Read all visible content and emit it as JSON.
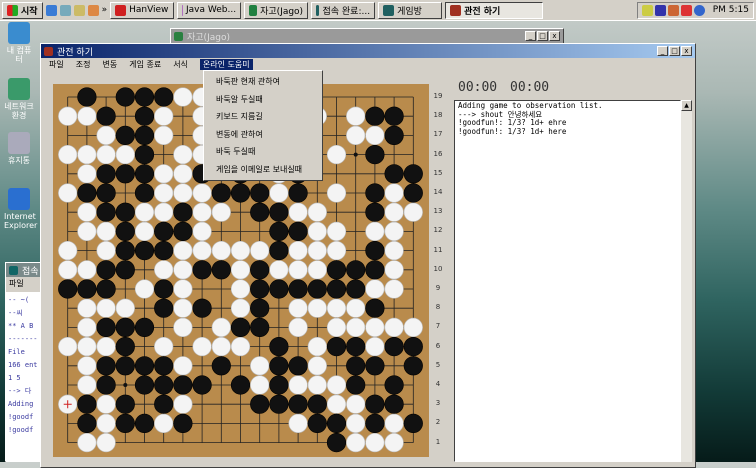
{
  "taskbar": {
    "start": "시작",
    "quicklaunch_more": "»",
    "items": [
      {
        "label": "HanView",
        "color": "#d02020"
      },
      {
        "label": "Java Web...",
        "color": "#b070c0"
      },
      {
        "label": "자고(Jago)",
        "color": "#208040"
      },
      {
        "label": "접속 완료:...",
        "color": "#206060"
      },
      {
        "label": "게임방",
        "color": "#206060"
      },
      {
        "label": "관전 하기",
        "color": "#a03020",
        "active": true
      }
    ],
    "clock": "PM 5:15"
  },
  "desktop": {
    "icons": [
      {
        "label": "내 컴퓨터"
      },
      {
        "label": "네트워크 환경"
      },
      {
        "label": "휴지통"
      },
      {
        "label": "Internet Explorer"
      }
    ]
  },
  "jago_window": {
    "title": "자고(Jago)"
  },
  "small_window": {
    "title": "접속",
    "menu": "파일",
    "lines": [
      "--  ~(",
      "--씨",
      "** A B",
      "-------",
      "File",
      "166 ent",
      "  1 5",
      "--> 다",
      "Adding",
      "!goodf",
      "!goodf"
    ]
  },
  "main_window": {
    "title": "관전 하기",
    "menu": [
      "파일",
      "조정",
      "변동",
      "게임 종료",
      "서식",
      "온라인 도움미"
    ],
    "help_menu": [
      "바둑판 현재 관하여",
      "바둑알 두실때",
      "키보드 지름길",
      "변동에 관하여",
      "바둑 두실때",
      "게임을 이메일로 보내실때"
    ],
    "timers": [
      "00:00",
      "00:00"
    ],
    "log": [
      "Adding game to observation list.",
      "---> shout 안녕하세요",
      "!goodfun!: 1/3?  1d+ ehre",
      "!goodfun!: 1/3?  1d+ here"
    ]
  },
  "board": {
    "size": 19,
    "last_move": "A3",
    "colors": {
      "black": "#111111",
      "white": "#f4f4f4",
      "wood": "#b98b4c",
      "marker": "#d02020"
    },
    "rows": [
      ".B.BBBWW...........",
      "WWB.BW.W.....W.WBB.",
      "..WBBW.W.......WWB.",
      "WWWWB.WW......W.B..",
      ".WBBBWWB.B.WB....BB",
      "WBB.BWWWBBBWB.W.BWB",
      ".WBBWWBWW.BBWW..BWW",
      ".WWBWBBW...BBWW.WW.",
      "W.WBBBWWWWWBWWW.BW.",
      "WWBB.WWBBWBWWWBBBW.",
      "BBB.WBW..WBBBBBBWW.",
      ".WWW.BWB.WB.WWWWB..",
      ".WBBB.W.WBB.W.WWWWW",
      "WWWB.W.WWW.B.WBBWBB",
      ".WBBBBW.B.WBBW.BB.B",
      ".WB.BBBB.BWBWWWB.B.",
      "WBWB.BW...BBBBWWBB.",
      ".BWBBWB.....WBBWBWB",
      ".WW...........BWWW."
    ],
    "row_labels": [
      "19",
      "18",
      "17",
      "16",
      "15",
      "14",
      "13",
      "12",
      "11",
      "10",
      "9",
      "8",
      "7",
      "6",
      "5",
      "4",
      "3",
      "2",
      "1"
    ]
  }
}
